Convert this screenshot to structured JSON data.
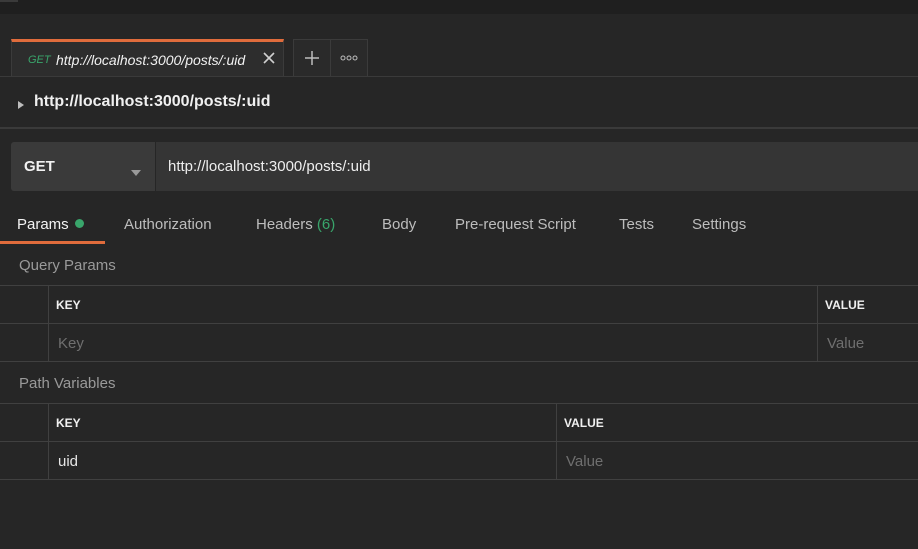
{
  "tabs": {
    "request_tab": {
      "method": "GET",
      "title": "http://localhost:3000/posts/:uid"
    }
  },
  "request": {
    "name": "http://localhost:3000/posts/:uid",
    "method": "GET",
    "url": "http://localhost:3000/posts/:uid"
  },
  "subtabs": {
    "params": "Params",
    "authorization": "Authorization",
    "headers": "Headers",
    "headers_count": "(6)",
    "body": "Body",
    "prerequest": "Pre-request Script",
    "tests": "Tests",
    "settings": "Settings"
  },
  "query_params": {
    "title": "Query Params",
    "key_header": "KEY",
    "value_header": "VALUE",
    "key_placeholder": "Key",
    "value_placeholder": "Value"
  },
  "path_variables": {
    "title": "Path Variables",
    "key_header": "KEY",
    "value_header": "VALUE",
    "rows": [
      {
        "key": "uid",
        "value_placeholder": "Value"
      }
    ]
  },
  "colors": {
    "accent": "#e06c3c",
    "method_green": "#39a56b",
    "background": "#262626"
  },
  "icons": [
    "close-icon",
    "plus-icon",
    "more-icon",
    "caret-right-icon",
    "chevron-down-icon"
  ]
}
